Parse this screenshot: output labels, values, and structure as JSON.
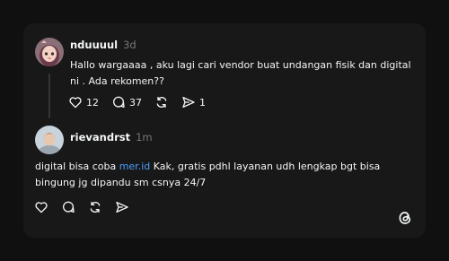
{
  "post": {
    "username": "nduuuul",
    "time": "3d",
    "text": "Hallo wargaaaa , aku lagi cari vendor buat undangan fisik dan digital ni . Ada rekomen??",
    "likes": "12",
    "comments": "37",
    "shares": "1"
  },
  "reply": {
    "username": "rievandrst",
    "time": "1m",
    "text_before_link": "digital bisa coba ",
    "link_text": "mer.id",
    "text_after_link": " Kak, gratis pdhl layanan udh lengkap bgt bisa bingung jg dipandu sm csnya 24/7"
  },
  "colors": {
    "background": "#101010",
    "card": "#181818",
    "text": "#f3f5f7",
    "muted": "#777777",
    "link": "#4a9eff"
  },
  "icons": [
    "heart-icon",
    "comment-icon",
    "repost-icon",
    "share-icon",
    "threads-logo-icon"
  ]
}
